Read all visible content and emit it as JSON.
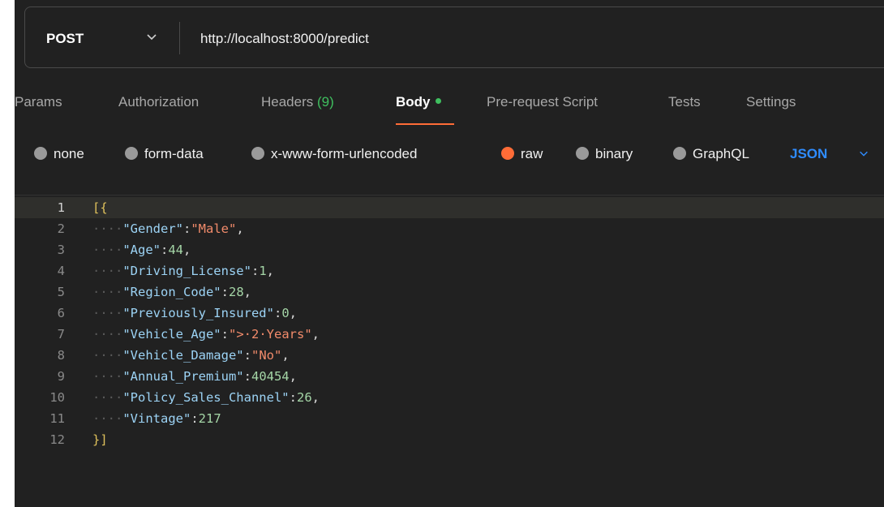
{
  "request": {
    "method": "POST",
    "url": "http://localhost:8000/predict"
  },
  "tabs": [
    {
      "label": "Params"
    },
    {
      "label": "Authorization"
    },
    {
      "label": "Headers",
      "count": "(9)"
    },
    {
      "label": "Body",
      "active": true
    },
    {
      "label": "Pre-request Script"
    },
    {
      "label": "Tests"
    },
    {
      "label": "Settings"
    }
  ],
  "body_types": [
    {
      "label": "none",
      "checked": false
    },
    {
      "label": "form-data",
      "checked": false
    },
    {
      "label": "x-www-form-urlencoded",
      "checked": false
    },
    {
      "label": "raw",
      "checked": true
    },
    {
      "label": "binary",
      "checked": false
    },
    {
      "label": "GraphQL",
      "checked": false
    }
  ],
  "format": "JSON",
  "editor": {
    "current_line": 1,
    "lines": [
      {
        "n": "1",
        "open": "[{"
      },
      {
        "n": "2",
        "key": "\"Gender\"",
        "value": "\"Male\"",
        "type": "str",
        "comma": true
      },
      {
        "n": "3",
        "key": "\"Age\"",
        "value": "44",
        "type": "num",
        "comma": true
      },
      {
        "n": "4",
        "key": "\"Driving_License\"",
        "value": "1",
        "type": "num",
        "comma": true
      },
      {
        "n": "5",
        "key": "\"Region_Code\"",
        "value": "28",
        "type": "num",
        "comma": true
      },
      {
        "n": "6",
        "key": "\"Previously_Insured\"",
        "value": "0",
        "type": "num",
        "comma": true
      },
      {
        "n": "7",
        "key": "\"Vehicle_Age\"",
        "value": "\"> 2 Years\"",
        "type": "str",
        "comma": true
      },
      {
        "n": "8",
        "key": "\"Vehicle_Damage\"",
        "value": "\"No\"",
        "type": "str",
        "comma": true
      },
      {
        "n": "9",
        "key": "\"Annual_Premium\"",
        "value": "40454",
        "type": "num",
        "comma": true
      },
      {
        "n": "10",
        "key": "\"Policy_Sales_Channel\"",
        "value": "26",
        "type": "num",
        "comma": true
      },
      {
        "n": "11",
        "key": "\"Vintage\"",
        "value": "217",
        "type": "num",
        "comma": false
      },
      {
        "n": "12",
        "open": "}]"
      }
    ]
  },
  "colors": {
    "accent": "#ff6c37",
    "active_dot": "#3fbf5f",
    "format_link": "#2f8cff"
  }
}
